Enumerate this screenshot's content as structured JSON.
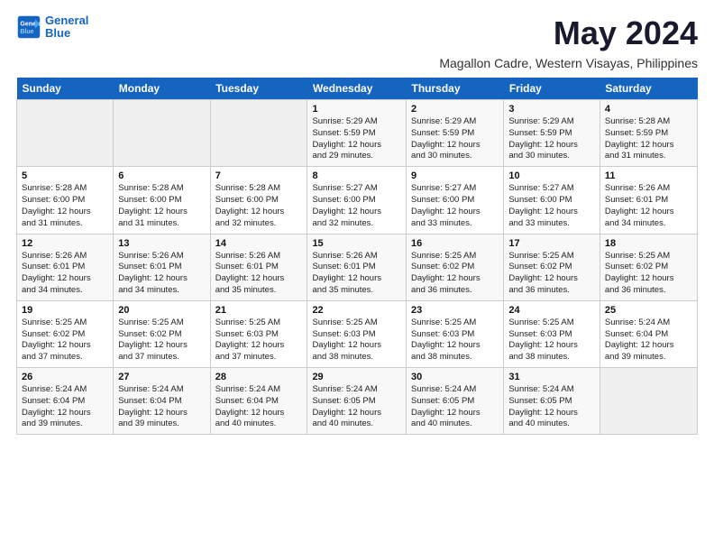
{
  "logo": {
    "line1": "General",
    "line2": "Blue"
  },
  "title": "May 2024",
  "subtitle": "Magallon Cadre, Western Visayas, Philippines",
  "days_of_week": [
    "Sunday",
    "Monday",
    "Tuesday",
    "Wednesday",
    "Thursday",
    "Friday",
    "Saturday"
  ],
  "weeks": [
    [
      {
        "num": "",
        "info": ""
      },
      {
        "num": "",
        "info": ""
      },
      {
        "num": "",
        "info": ""
      },
      {
        "num": "1",
        "info": "Sunrise: 5:29 AM\nSunset: 5:59 PM\nDaylight: 12 hours\nand 29 minutes."
      },
      {
        "num": "2",
        "info": "Sunrise: 5:29 AM\nSunset: 5:59 PM\nDaylight: 12 hours\nand 30 minutes."
      },
      {
        "num": "3",
        "info": "Sunrise: 5:29 AM\nSunset: 5:59 PM\nDaylight: 12 hours\nand 30 minutes."
      },
      {
        "num": "4",
        "info": "Sunrise: 5:28 AM\nSunset: 5:59 PM\nDaylight: 12 hours\nand 31 minutes."
      }
    ],
    [
      {
        "num": "5",
        "info": "Sunrise: 5:28 AM\nSunset: 6:00 PM\nDaylight: 12 hours\nand 31 minutes."
      },
      {
        "num": "6",
        "info": "Sunrise: 5:28 AM\nSunset: 6:00 PM\nDaylight: 12 hours\nand 31 minutes."
      },
      {
        "num": "7",
        "info": "Sunrise: 5:28 AM\nSunset: 6:00 PM\nDaylight: 12 hours\nand 32 minutes."
      },
      {
        "num": "8",
        "info": "Sunrise: 5:27 AM\nSunset: 6:00 PM\nDaylight: 12 hours\nand 32 minutes."
      },
      {
        "num": "9",
        "info": "Sunrise: 5:27 AM\nSunset: 6:00 PM\nDaylight: 12 hours\nand 33 minutes."
      },
      {
        "num": "10",
        "info": "Sunrise: 5:27 AM\nSunset: 6:00 PM\nDaylight: 12 hours\nand 33 minutes."
      },
      {
        "num": "11",
        "info": "Sunrise: 5:26 AM\nSunset: 6:01 PM\nDaylight: 12 hours\nand 34 minutes."
      }
    ],
    [
      {
        "num": "12",
        "info": "Sunrise: 5:26 AM\nSunset: 6:01 PM\nDaylight: 12 hours\nand 34 minutes."
      },
      {
        "num": "13",
        "info": "Sunrise: 5:26 AM\nSunset: 6:01 PM\nDaylight: 12 hours\nand 34 minutes."
      },
      {
        "num": "14",
        "info": "Sunrise: 5:26 AM\nSunset: 6:01 PM\nDaylight: 12 hours\nand 35 minutes."
      },
      {
        "num": "15",
        "info": "Sunrise: 5:26 AM\nSunset: 6:01 PM\nDaylight: 12 hours\nand 35 minutes."
      },
      {
        "num": "16",
        "info": "Sunrise: 5:25 AM\nSunset: 6:02 PM\nDaylight: 12 hours\nand 36 minutes."
      },
      {
        "num": "17",
        "info": "Sunrise: 5:25 AM\nSunset: 6:02 PM\nDaylight: 12 hours\nand 36 minutes."
      },
      {
        "num": "18",
        "info": "Sunrise: 5:25 AM\nSunset: 6:02 PM\nDaylight: 12 hours\nand 36 minutes."
      }
    ],
    [
      {
        "num": "19",
        "info": "Sunrise: 5:25 AM\nSunset: 6:02 PM\nDaylight: 12 hours\nand 37 minutes."
      },
      {
        "num": "20",
        "info": "Sunrise: 5:25 AM\nSunset: 6:02 PM\nDaylight: 12 hours\nand 37 minutes."
      },
      {
        "num": "21",
        "info": "Sunrise: 5:25 AM\nSunset: 6:03 PM\nDaylight: 12 hours\nand 37 minutes."
      },
      {
        "num": "22",
        "info": "Sunrise: 5:25 AM\nSunset: 6:03 PM\nDaylight: 12 hours\nand 38 minutes."
      },
      {
        "num": "23",
        "info": "Sunrise: 5:25 AM\nSunset: 6:03 PM\nDaylight: 12 hours\nand 38 minutes."
      },
      {
        "num": "24",
        "info": "Sunrise: 5:25 AM\nSunset: 6:03 PM\nDaylight: 12 hours\nand 38 minutes."
      },
      {
        "num": "25",
        "info": "Sunrise: 5:24 AM\nSunset: 6:04 PM\nDaylight: 12 hours\nand 39 minutes."
      }
    ],
    [
      {
        "num": "26",
        "info": "Sunrise: 5:24 AM\nSunset: 6:04 PM\nDaylight: 12 hours\nand 39 minutes."
      },
      {
        "num": "27",
        "info": "Sunrise: 5:24 AM\nSunset: 6:04 PM\nDaylight: 12 hours\nand 39 minutes."
      },
      {
        "num": "28",
        "info": "Sunrise: 5:24 AM\nSunset: 6:04 PM\nDaylight: 12 hours\nand 40 minutes."
      },
      {
        "num": "29",
        "info": "Sunrise: 5:24 AM\nSunset: 6:05 PM\nDaylight: 12 hours\nand 40 minutes."
      },
      {
        "num": "30",
        "info": "Sunrise: 5:24 AM\nSunset: 6:05 PM\nDaylight: 12 hours\nand 40 minutes."
      },
      {
        "num": "31",
        "info": "Sunrise: 5:24 AM\nSunset: 6:05 PM\nDaylight: 12 hours\nand 40 minutes."
      },
      {
        "num": "",
        "info": ""
      }
    ]
  ]
}
